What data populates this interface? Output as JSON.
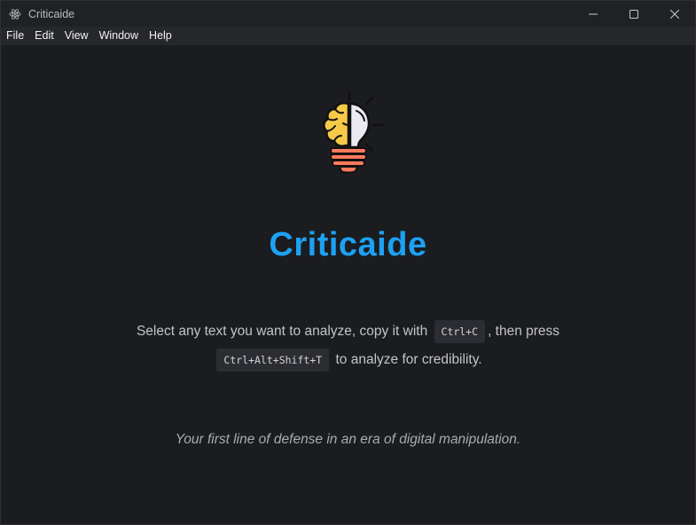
{
  "window": {
    "title": "Criticaide"
  },
  "menu": {
    "items": [
      "File",
      "Edit",
      "View",
      "Window",
      "Help"
    ]
  },
  "main": {
    "heading": "Criticaide",
    "instruction_part1": "Select any text you want to analyze, copy it with",
    "shortcut_copy": "Ctrl+C",
    "instruction_part2": ", then press",
    "shortcut_analyze": "Ctrl+Alt+Shift+T",
    "instruction_part3": "to analyze for credibility.",
    "tagline": "Your first line of defense in an era of digital manipulation."
  },
  "colors": {
    "accent": "#1da1f2",
    "background": "#1b1c20",
    "brain": "#f7c948",
    "bulb": "#eaeaf2",
    "base": "#ff7a5c"
  },
  "icons": {
    "app": "electron-icon",
    "logo": "brain-lightbulb-icon"
  }
}
